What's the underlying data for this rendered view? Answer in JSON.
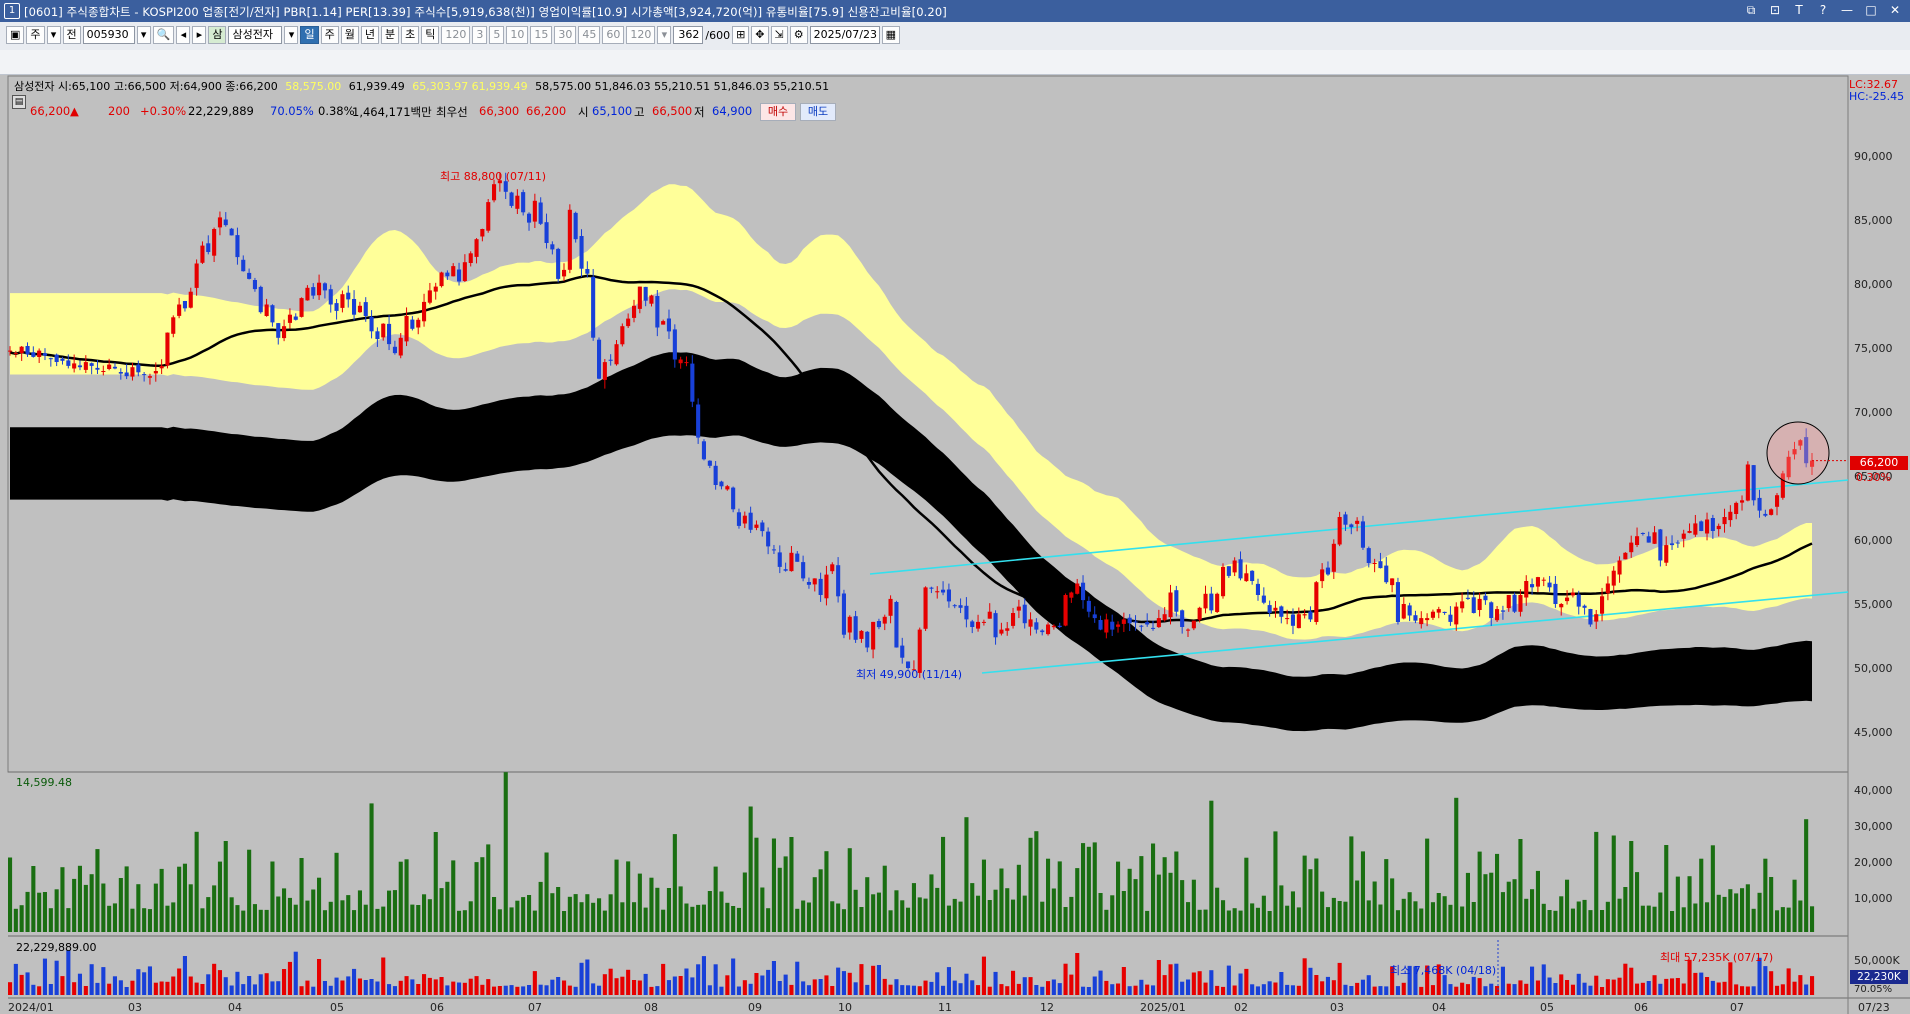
{
  "window": {
    "title": "[0601] 주식종합차트 - KOSPI200 업종[전기/전자]  PBR[1.14]  PER[13.39]  주식수[5,919,638(천)]  영업이익률[10.9]  시가총액[3,924,720(억)]  유통비율[75.9]  신용잔고비율[0.20]",
    "icon": "1",
    "controls": [
      "restore-icon",
      "link-icon",
      "t-icon",
      "help-icon",
      "minimize-icon",
      "maximize-icon",
      "close-icon"
    ]
  },
  "toolbar": {
    "mode_labels": [
      "주",
      "전"
    ],
    "code": "005930",
    "stock_name_badge": "삼",
    "stock_name": "삼성전자",
    "periods": [
      "일",
      "주",
      "월",
      "년",
      "분",
      "초",
      "틱"
    ],
    "intervals": [
      "120",
      "3",
      "5",
      "10",
      "15",
      "30",
      "45",
      "60",
      "120"
    ],
    "count": "362",
    "count_total": "/600",
    "date": "2025/07/23"
  },
  "quote": {
    "price": "66,200",
    "arrow": "▲",
    "change": "200",
    "change_pct": "+0.30%",
    "volume": "22,229,889",
    "vol_ratio": "70.05%",
    "turnover": "0.38%",
    "amount": "1,464,171백만",
    "best_ask_label": "최우선",
    "best_ask": "66,300",
    "best_bid": "66,200",
    "open_label": "시",
    "open": "65,100",
    "high_label": "고",
    "high": "66,500",
    "low_label": "저",
    "low": "64,900",
    "buy_label": "매수",
    "sell_label": "매도"
  },
  "info_line": {
    "main": "삼성전자 시:65,100 고:66,500 저:64,900 종:66,200",
    "v1": "58,575.00",
    "v2": "61,939.49",
    "v3": "65,303.97 61,939.49",
    "v4": "58,575.00 51,846.03 55,210.51 51,846.03 55,210.51"
  },
  "right_axis": {
    "lc": "LC:32.67",
    "hc": "HC:-25.45",
    "price_ticks": [
      "90,000",
      "85,000",
      "80,000",
      "75,000",
      "70,000",
      "65,000",
      "60,000",
      "55,000",
      "50,000",
      "45,000"
    ],
    "current_price": "66,200",
    "current_pct": "0.30%",
    "vol_ticks": [
      "40,000",
      "30,000",
      "20,000",
      "10,000"
    ],
    "amt_ticks": [
      "50,000K"
    ],
    "amt_current": "22,230K",
    "amt_pct": "70.05%"
  },
  "x_axis": {
    "labels": [
      "2024/01",
      "03",
      "04",
      "05",
      "06",
      "07",
      "08",
      "09",
      "10",
      "11",
      "12",
      "2025/01",
      "02",
      "03",
      "04",
      "05",
      "06",
      "07",
      "07/23"
    ]
  },
  "annotations": {
    "high": "최고 88,800 (07/11)",
    "low": "최저 49,900 (11/14)",
    "vol_panel_value": "14,599.48",
    "amt_panel_value": "22,229,889.00",
    "amt_min": "최소 7,468K (04/18)",
    "amt_max": "최대 57,235K (07/17)"
  },
  "colors": {
    "up": "#e60000",
    "down": "#1840d8",
    "upper_band": "#ffff99",
    "lower_band": "#000000",
    "trendline": "#33e0ee",
    "volume": "#1a6e12",
    "background": "#c0c0c0"
  },
  "chart_data": {
    "type": "candlestick",
    "ylim": [
      44000,
      93000
    ],
    "closes": [
      74800,
      74600,
      75100,
      74500,
      74300,
      74800,
      74400,
      74200,
      73900,
      74000,
      73600,
      73800,
      73500,
      73900,
      73600,
      73300,
      73200,
      73700,
      73400,
      73000,
      72800,
      73500,
      73100,
      72900,
      72800,
      73200,
      73600,
      76200,
      77400,
      78400,
      78100,
      79400,
      81600,
      83000,
      82500,
      84300,
      85200,
      84600,
      83800,
      82100,
      81000,
      80400,
      79600,
      77800,
      78400,
      77000,
      75800,
      76700,
      77600,
      77200,
      78900,
      79700,
      79100,
      80100,
      79500,
      78400,
      77900,
      79200,
      78800,
      77600,
      78300,
      77500,
      76300,
      75700,
      76900,
      75300,
      74600,
      75800,
      77500,
      76500,
      77200,
      78600,
      79500,
      79800,
      80900,
      80600,
      81400,
      80200,
      81700,
      82400,
      83500,
      84300,
      86400,
      87800,
      88100,
      87200,
      86100,
      86900,
      85600,
      84800,
      86500,
      84700,
      83200,
      82700,
      80400,
      81100,
      85800,
      83500,
      81200,
      80800,
      75800,
      72600,
      73900,
      74000,
      75300,
      76700,
      77300,
      78300,
      79800,
      78700,
      79100,
      76600,
      77100,
      76300,
      74100,
      74100,
      73900,
      70800,
      68000,
      66300,
      65800,
      64300,
      64200,
      64200,
      62400,
      61100,
      61900,
      60800,
      61200,
      60700,
      59500,
      59200,
      57900,
      57600,
      59000,
      58300,
      57000,
      56500,
      57000,
      55700,
      57300,
      58100,
      55600,
      52600,
      54000,
      52200,
      52900,
      51600,
      53600,
      53200,
      54000,
      55400,
      51600,
      50800,
      50000,
      49900,
      53000,
      56300,
      56200,
      56000,
      55900,
      55200,
      54900,
      54700,
      53800,
      53200,
      53600,
      53600,
      54400,
      52400,
      53000,
      53100,
      54300,
      54800,
      53500,
      53800,
      53000,
      52800,
      53400,
      53300,
      53200,
      55700,
      55900,
      56600,
      55300,
      54400,
      53900,
      53000,
      53800,
      53000,
      53400,
      53800,
      53500,
      53600,
      53300,
      53400,
      53100,
      53900,
      54200,
      55900,
      54400,
      53200,
      53000,
      53700,
      54700,
      55800,
      54500,
      55800,
      57900,
      57200,
      58400,
      57000,
      57400,
      56800,
      55700,
      55100,
      54300,
      54700,
      54000,
      53900,
      53300,
      54200,
      54200,
      53800,
      56700,
      57700,
      57300,
      59700,
      61800,
      61200,
      61000,
      61500,
      59400,
      58200,
      58200,
      57800,
      56700,
      57000,
      53600,
      55000,
      54100,
      53700,
      53900,
      53900,
      54400,
      54600,
      54300,
      53600,
      54800,
      55200,
      55400,
      54300,
      55400,
      55300,
      53900,
      54600,
      54400,
      55700,
      54400,
      55700,
      56800,
      56300,
      57100,
      56900,
      56300,
      55000,
      55000,
      55500,
      55900,
      54800,
      54700,
      53400,
      54200,
      55600,
      56600,
      57600,
      58400,
      59000,
      59800,
      60300,
      60500,
      59800,
      60600,
      58400,
      59600,
      59600,
      59800,
      60500,
      60700,
      61300,
      60700,
      61600,
      60700,
      61100,
      61800,
      62200,
      62900,
      63100,
      65900,
      63100,
      62300,
      61900,
      62400,
      63500,
      65200,
      66500,
      67100,
      67800,
      66000,
      66200
    ],
    "mode_note": "one close per trading day, 2024/01 to 2025/07/23"
  }
}
